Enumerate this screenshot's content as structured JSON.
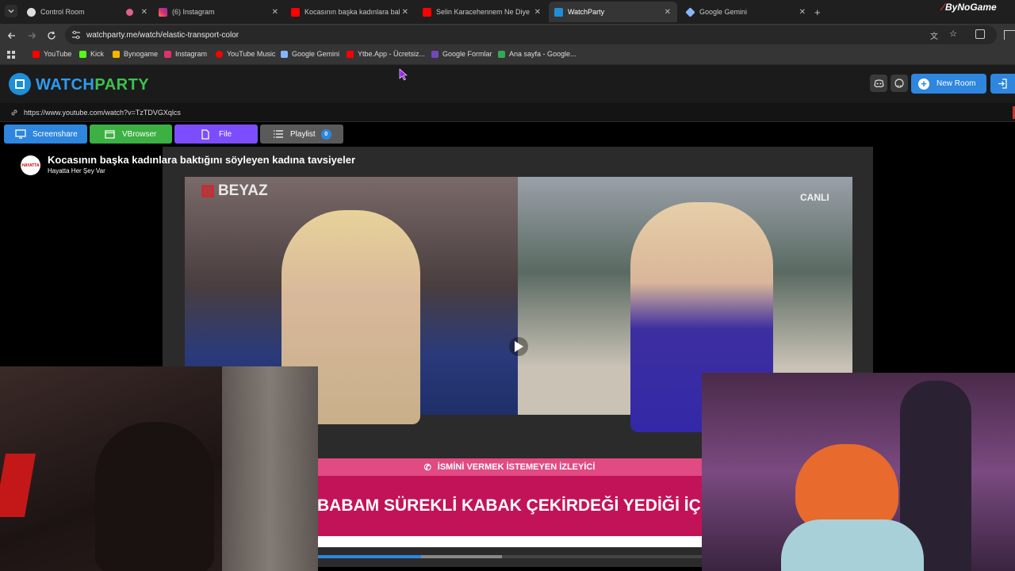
{
  "browser": {
    "tabs": [
      {
        "title": "Control Room",
        "icon": "control-room-icon"
      },
      {
        "title": "(6) Instagram",
        "icon": "instagram-icon"
      },
      {
        "title": "Kocasının başka kadınlara baktı...",
        "icon": "youtube-icon"
      },
      {
        "title": "Selin Karacehennem Ne Diyece...",
        "icon": "youtube-icon"
      },
      {
        "title": "WatchParty",
        "icon": "watchparty-icon"
      },
      {
        "title": "Google Gemini",
        "icon": "gemini-icon"
      }
    ],
    "address": "watchparty.me/watch/elastic-transport-color",
    "bookmarks": [
      {
        "label": "YouTube",
        "color": "#ff0000"
      },
      {
        "label": "Kick",
        "color": "#53fc18"
      },
      {
        "label": "Bynogame",
        "color": "#f5b400"
      },
      {
        "label": "Instagram",
        "color": "#e1306c"
      },
      {
        "label": "YouTube Music",
        "color": "#ff0000"
      },
      {
        "label": "Google Gemini",
        "color": "#8ab4f8"
      },
      {
        "label": "Ytbe.App - Ücretsiz...",
        "color": "#ff0000"
      },
      {
        "label": "Google Formlar",
        "color": "#7248b9"
      },
      {
        "label": "Ana sayfa - Google...",
        "color": "#34a853"
      }
    ],
    "watermark": "ByNoGame"
  },
  "watchparty": {
    "logo_part1": "WATCH",
    "logo_part2": "PARTY",
    "new_room_label": "New Room",
    "media_url": "https://www.youtube.com/watch?v=TzTDVGXqlcs",
    "controls": {
      "screenshare": "Screenshare",
      "vbrowser": "VBrowser",
      "file": "File",
      "playlist": "Playlist",
      "playlist_count": "0"
    },
    "colors": {
      "screenshare": "#2e86de",
      "vbrowser": "#3cb043",
      "file": "#7c4dff",
      "playlist": "#5a5a5a",
      "accent": "#1e8fd6"
    }
  },
  "video": {
    "title": "Kocasının başka kadınlara baktığını söyleyen kadına tavsiyeler",
    "channel": "Hayatta Her Şey Var",
    "channel_logo_text": "HAYATTA",
    "broadcaster": "BEYAZ",
    "live_label": "CANLI",
    "caller_label": "İSMİNİ VERMEK İSTEMEYEN İZLEYİCİ",
    "ticker": "BABAM SÜREKLİ KABAK ÇEKİRDEĞİ YEDİĞİ İÇİN ANN",
    "progress_played": 0.27,
    "progress_buffered": 0.48
  }
}
